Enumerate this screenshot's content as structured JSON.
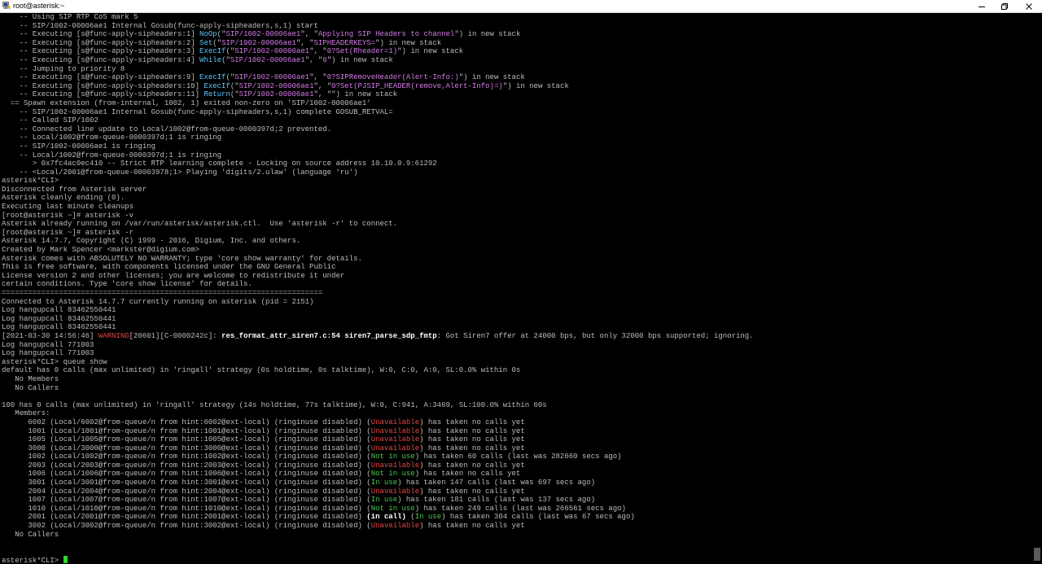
{
  "window": {
    "title": "root@asterisk:~",
    "icon": "putty-terminal-icon",
    "controls": [
      "minimize-icon",
      "maximize-icon",
      "close-icon"
    ]
  },
  "colors": {
    "background": "#000000",
    "text": "#bdbdbd",
    "function": "#5ec8ff",
    "string": "#d57ae8",
    "warning": "#e64545",
    "unavailable": "#e64545",
    "ok": "#49c94d",
    "cursor": "#2dd52d"
  },
  "terminal": {
    "lines": [
      [
        [
          "    -- Using SIP RTP CoS mark 5",
          ""
        ]
      ],
      [
        [
          "    -- SIP/1002-00006ae1 Internal Gosub(func-apply-sipheaders,s,1) start",
          ""
        ]
      ],
      [
        [
          "    -- Executing [s@func-apply-sipheaders:1] ",
          ""
        ],
        [
          "NoOp",
          "func"
        ],
        [
          "(\"",
          ""
        ],
        [
          "SIP/1002-00006ae1",
          "str"
        ],
        [
          "\", \"",
          ""
        ],
        [
          "Applying SIP Headers to channel",
          "str"
        ],
        [
          "\") in new stack",
          ""
        ]
      ],
      [
        [
          "    -- Executing [s@func-apply-sipheaders:2] ",
          ""
        ],
        [
          "Set",
          "func"
        ],
        [
          "(\"",
          ""
        ],
        [
          "SIP/1002-00006ae1",
          "str"
        ],
        [
          "\", \"",
          ""
        ],
        [
          "SIPHEADERKEYS=",
          "str"
        ],
        [
          "\") in new stack",
          ""
        ]
      ],
      [
        [
          "    -- Executing [s@func-apply-sipheaders:3] ",
          ""
        ],
        [
          "ExecIf",
          "func"
        ],
        [
          "(\"",
          ""
        ],
        [
          "SIP/1002-00006ae1",
          "str"
        ],
        [
          "\", \"",
          ""
        ],
        [
          "0?Set(Rheader=1)",
          "str"
        ],
        [
          "\") in new stack",
          ""
        ]
      ],
      [
        [
          "    -- Executing [s@func-apply-sipheaders:4] ",
          ""
        ],
        [
          "While",
          "func"
        ],
        [
          "(\"",
          ""
        ],
        [
          "SIP/1002-00006ae1",
          "str"
        ],
        [
          "\", \"",
          ""
        ],
        [
          "0",
          "str"
        ],
        [
          "\") in new stack",
          ""
        ]
      ],
      [
        [
          "    -- Jumping to priority 8",
          ""
        ]
      ],
      [
        [
          "    -- Executing [s@func-apply-sipheaders:9] ",
          ""
        ],
        [
          "ExecIf",
          "func"
        ],
        [
          "(\"",
          ""
        ],
        [
          "SIP/1002-00006ae1",
          "str"
        ],
        [
          "\", \"",
          ""
        ],
        [
          "0?SIPRemoveHeader(Alert-Info:)",
          "str"
        ],
        [
          "\") in new stack",
          ""
        ]
      ],
      [
        [
          "    -- Executing [s@func-apply-sipheaders:10] ",
          ""
        ],
        [
          "ExecIf",
          "func"
        ],
        [
          "(\"",
          ""
        ],
        [
          "SIP/1002-00006ae1",
          "str"
        ],
        [
          "\", \"",
          ""
        ],
        [
          "0?Set(PJSIP_HEADER(remove,Alert-Info)=)",
          "str"
        ],
        [
          "\") in new stack",
          ""
        ]
      ],
      [
        [
          "    -- Executing [s@func-apply-sipheaders:11] ",
          ""
        ],
        [
          "Return",
          "func"
        ],
        [
          "(\"",
          ""
        ],
        [
          "SIP/1002-00006ae1",
          "str"
        ],
        [
          "\", \"\") in new stack",
          ""
        ]
      ],
      [
        [
          "  == Spawn extension (from-internal, 1002, 1) exited non-zero on 'SIP/1002-00006ae1'",
          ""
        ]
      ],
      [
        [
          "    -- SIP/1002-00006ae1 Internal Gosub(func-apply-sipheaders,s,1) complete GOSUB_RETVAL=",
          ""
        ]
      ],
      [
        [
          "    -- Called SIP/1002",
          ""
        ]
      ],
      [
        [
          "    -- Connected line update to Local/1002@from-queue-0000397d;2 prevented.",
          ""
        ]
      ],
      [
        [
          "    -- Local/1002@from-queue-0000397d;1 is ringing",
          ""
        ]
      ],
      [
        [
          "    -- SIP/1002-00006ae1 is ringing",
          ""
        ]
      ],
      [
        [
          "    -- Local/1002@from-queue-0000397d;1 is ringing",
          ""
        ]
      ],
      [
        [
          "       > 0x7fc4ac0ec410 -- Strict RTP learning complete - Locking on source address 10.10.0.9:61292",
          ""
        ]
      ],
      [
        [
          "    -- <Local/2001@from-queue-00003978;1> Playing 'digits/2.ulaw' (language 'ru')",
          ""
        ]
      ],
      [
        [
          "asterisk*CLI>",
          ""
        ]
      ],
      [
        [
          "Disconnected from Asterisk server",
          ""
        ]
      ],
      [
        [
          "Asterisk cleanly ending (0).",
          ""
        ]
      ],
      [
        [
          "Executing last minute cleanups",
          ""
        ]
      ],
      [
        [
          "[root@asterisk ~]# asterisk -v",
          ""
        ]
      ],
      [
        [
          "Asterisk already running on /var/run/asterisk/asterisk.ctl.  Use 'asterisk -r' to connect.",
          ""
        ]
      ],
      [
        [
          "[root@asterisk ~]# asterisk -r",
          ""
        ]
      ],
      [
        [
          "Asterisk 14.7.7, Copyright (C) 1999 - 2016, Digium, Inc. and others.",
          ""
        ]
      ],
      [
        [
          "Created by Mark Spencer <markster@digium.com>",
          ""
        ]
      ],
      [
        [
          "Asterisk comes with ABSOLUTELY NO WARRANTY; type 'core show warranty' for details.",
          ""
        ]
      ],
      [
        [
          "This is free software, with components licensed under the GNU General Public",
          ""
        ]
      ],
      [
        [
          "License version 2 and other licenses; you are welcome to redistribute it under",
          ""
        ]
      ],
      [
        [
          "certain conditions. Type 'core show license' for details.",
          ""
        ]
      ],
      [
        [
          "=========================================================================",
          ""
        ]
      ],
      [
        [
          "Connected to Asterisk 14.7.7 currently running on asterisk (pid = 2151)",
          ""
        ]
      ],
      [
        [
          "Log hangupcall 83462550441",
          ""
        ]
      ],
      [
        [
          "Log hangupcall 83462550441",
          ""
        ]
      ],
      [
        [
          "Log hangupcall 83462550441",
          ""
        ]
      ],
      [
        [
          "[2021-03-30 14:56:46] ",
          ""
        ],
        [
          "WARNING",
          "warn"
        ],
        [
          "[20601][C-0000242c]: ",
          ""
        ],
        [
          "res_format_attr_siren7.c:54 siren7_parse_sdp_fmtp",
          "bold"
        ],
        [
          ": Got Siren7 offer at 24000 bps, but only 32000 bps supported; ignoring.",
          ""
        ]
      ],
      [
        [
          "Log hangupcall 771003",
          ""
        ]
      ],
      [
        [
          "Log hangupcall 771003",
          ""
        ]
      ],
      [
        [
          "asterisk*CLI> queue show",
          ""
        ]
      ],
      [
        [
          "default has 0 calls (max unlimited) in 'ringall' strategy (0s holdtime, 0s talktime), W:0, C:0, A:0, SL:0.0% within 0s",
          ""
        ]
      ],
      [
        [
          "   No Members",
          ""
        ]
      ],
      [
        [
          "   No Callers",
          ""
        ]
      ],
      [
        [
          "",
          ""
        ]
      ],
      [
        [
          "100 has 0 calls (max unlimited) in 'ringall' strategy (14s holdtime, 77s talktime), W:0, C:941, A:3469, SL:100.0% within 60s",
          ""
        ]
      ],
      [
        [
          "   Members:",
          ""
        ]
      ],
      [
        [
          "      6002 (Local/6002@from-queue/n from hint:6002@ext-local) (ringinuse disabled) (",
          ""
        ],
        [
          "Unavailable",
          "unav"
        ],
        [
          ") has taken no calls yet",
          ""
        ]
      ],
      [
        [
          "      1001 (Local/1001@from-queue/n from hint:1001@ext-local) (ringinuse disabled) (",
          ""
        ],
        [
          "Unavailable",
          "unav"
        ],
        [
          ") has taken no calls yet",
          ""
        ]
      ],
      [
        [
          "      1005 (Local/1005@from-queue/n from hint:1005@ext-local) (ringinuse disabled) (",
          ""
        ],
        [
          "Unavailable",
          "unav"
        ],
        [
          ") has taken no calls yet",
          ""
        ]
      ],
      [
        [
          "      3000 (Local/3000@from-queue/n from hint:3000@ext-local) (ringinuse disabled) (",
          ""
        ],
        [
          "Unavailable",
          "unav"
        ],
        [
          ") has taken no calls yet",
          ""
        ]
      ],
      [
        [
          "      1002 (Local/1002@from-queue/n from hint:1002@ext-local) (ringinuse disabled) (",
          ""
        ],
        [
          "Not in use",
          "free"
        ],
        [
          ") has taken 60 calls (last was 282660 secs ago)",
          ""
        ]
      ],
      [
        [
          "      2003 (Local/2003@from-queue/n from hint:2003@ext-local) (ringinuse disabled) (",
          ""
        ],
        [
          "Unavailable",
          "unav"
        ],
        [
          ") has taken no calls yet",
          ""
        ]
      ],
      [
        [
          "      1006 (Local/1006@from-queue/n from hint:1006@ext-local) (ringinuse disabled) (",
          ""
        ],
        [
          "Not in use",
          "free"
        ],
        [
          ") has taken no calls yet",
          ""
        ]
      ],
      [
        [
          "      3001 (Local/3001@from-queue/n from hint:3001@ext-local) (ringinuse disabled) (",
          ""
        ],
        [
          "In use",
          "use"
        ],
        [
          ") has taken 147 calls (last was 697 secs ago)",
          ""
        ]
      ],
      [
        [
          "      2004 (Local/2004@from-queue/n from hint:2004@ext-local) (ringinuse disabled) (",
          ""
        ],
        [
          "Unavailable",
          "unav"
        ],
        [
          ") has taken no calls yet",
          ""
        ]
      ],
      [
        [
          "      1007 (Local/1007@from-queue/n from hint:1007@ext-local) (ringinuse disabled) (",
          ""
        ],
        [
          "In use",
          "use"
        ],
        [
          ") has taken 181 calls (last was 137 secs ago)",
          ""
        ]
      ],
      [
        [
          "      1010 (Local/1010@from-queue/n from hint:1010@ext-local) (ringinuse disabled) (",
          ""
        ],
        [
          "Not in use",
          "free"
        ],
        [
          ") has taken 249 calls (last was 266561 secs ago)",
          ""
        ]
      ],
      [
        [
          "      2001 (Local/2001@from-queue/n from hint:2001@ext-local) (ringinuse disabled) ",
          ""
        ],
        [
          "(in call)",
          "call"
        ],
        [
          " (",
          ""
        ],
        [
          "In use",
          "use"
        ],
        [
          ") has taken 304 calls (last was 67 secs ago)",
          ""
        ]
      ],
      [
        [
          "      3002 (Local/3002@from-queue/n from hint:3002@ext-local) (ringinuse disabled) (",
          ""
        ],
        [
          "Unavailable",
          "unav"
        ],
        [
          ") has taken no calls yet",
          ""
        ]
      ],
      [
        [
          "   No Callers",
          ""
        ]
      ],
      [
        [
          "",
          ""
        ]
      ],
      [
        [
          "",
          ""
        ]
      ]
    ],
    "prompt": "asterisk*CLI> "
  }
}
